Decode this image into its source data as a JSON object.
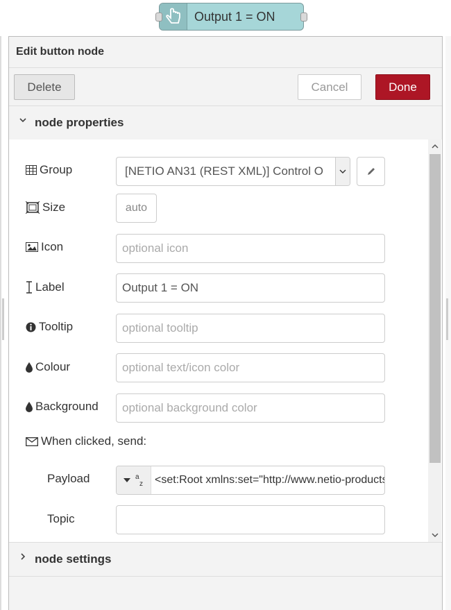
{
  "flow_node": {
    "label": "Output 1 = ON",
    "icon": "touch-icon"
  },
  "tray": {
    "title": "Edit button node",
    "buttons": {
      "delete": "Delete",
      "cancel": "Cancel",
      "done": "Done"
    },
    "colors": {
      "done": "#ad1625",
      "node": "#a6d6d8"
    }
  },
  "properties_section": {
    "title": "node properties"
  },
  "settings_section": {
    "title": "node settings"
  },
  "fields": {
    "group": {
      "label": "Group",
      "icon": "table-icon",
      "value": "[NETIO AN31 (REST XML)] Control O"
    },
    "size": {
      "label": "Size",
      "icon": "size-icon",
      "value": "auto"
    },
    "icon": {
      "label": "Icon",
      "icon": "picture-icon",
      "placeholder": "optional icon"
    },
    "label": {
      "label": "Label",
      "icon": "text-cursor-icon",
      "value": "Output 1 = ON"
    },
    "tooltip": {
      "label": "Tooltip",
      "icon": "info-icon",
      "placeholder": "optional tooltip"
    },
    "colour": {
      "label": "Colour",
      "icon": "droplet-icon",
      "placeholder": "optional text/icon color"
    },
    "background": {
      "label": "Background",
      "icon": "droplet-icon",
      "placeholder": "optional background color"
    },
    "when_clicked": {
      "label": "When clicked, send:",
      "icon": "envelope-icon"
    },
    "payload": {
      "label": "Payload",
      "type_icon": "string-type-icon",
      "value": "<set:Root xmlns:set=\"http://www.netio-products.com/XMLSchema/NETIO.xsd\">"
    },
    "topic": {
      "label": "Topic",
      "value": ""
    }
  }
}
